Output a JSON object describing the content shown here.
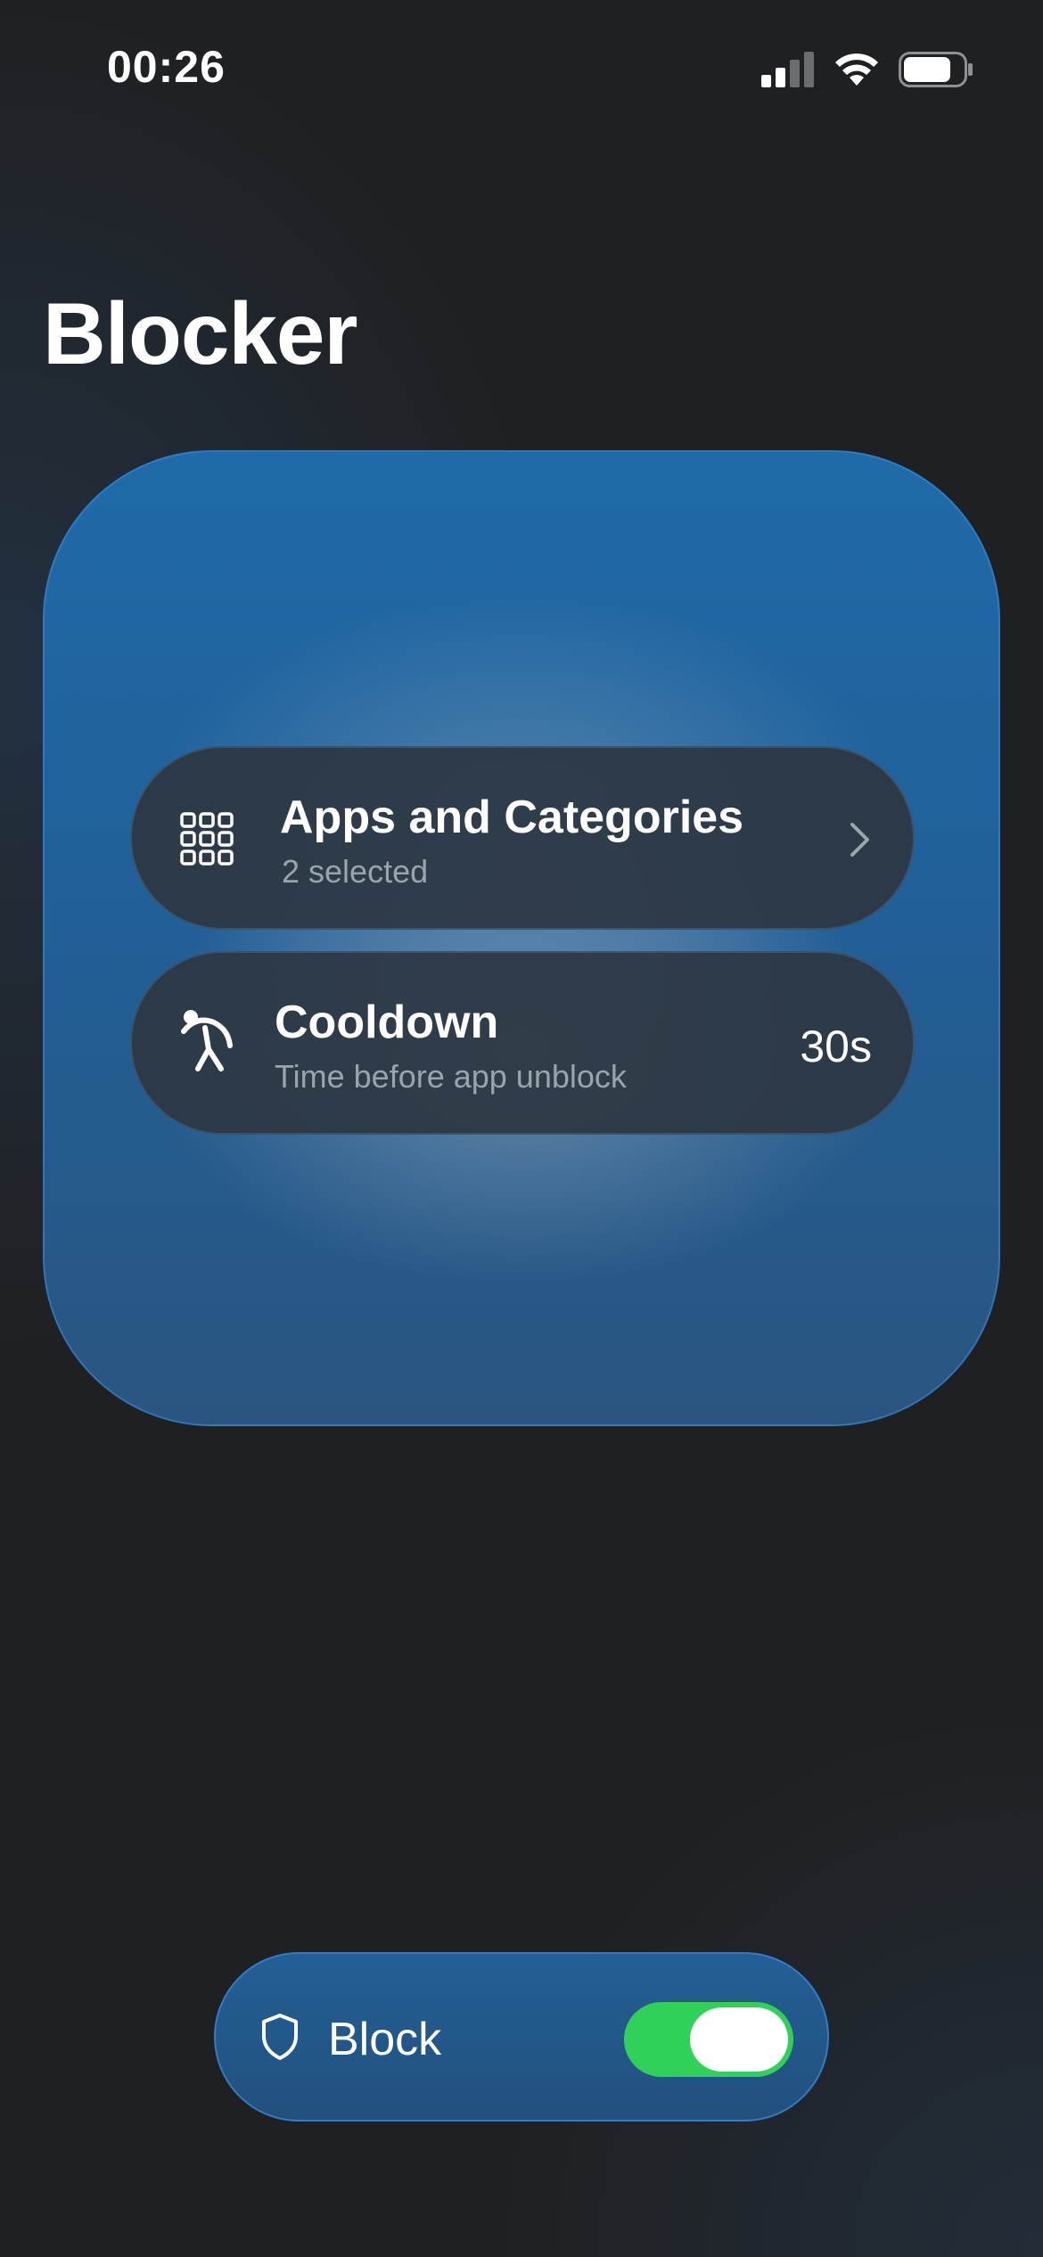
{
  "status_bar": {
    "time": "00:26"
  },
  "page": {
    "title": "Blocker"
  },
  "settings": {
    "apps": {
      "title": "Apps and Categories",
      "subtitle": "2 selected",
      "icon": "grid-icon"
    },
    "cooldown": {
      "title": "Cooldown",
      "subtitle": "Time before app unblock",
      "value": "30s",
      "icon": "stretch-icon"
    }
  },
  "block_control": {
    "label": "Block",
    "enabled": true,
    "icon": "shield-icon"
  },
  "colors": {
    "toggle_on": "#30d158",
    "accent_blue": "#1f6aa8"
  }
}
